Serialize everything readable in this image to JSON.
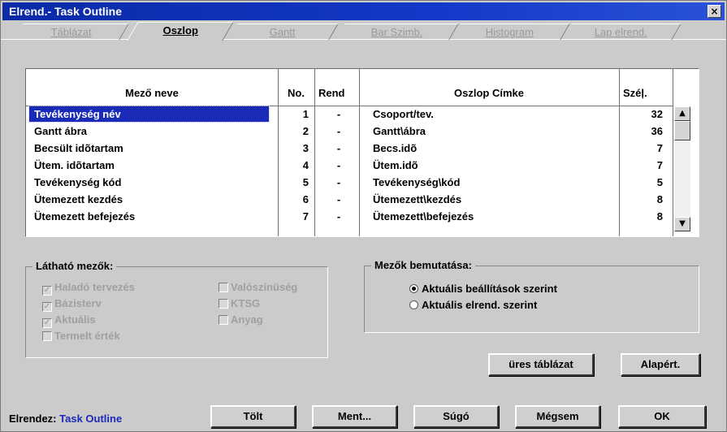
{
  "window": {
    "title": "Elrend.- Task Outline",
    "close_glyph": "×"
  },
  "tabs": [
    {
      "label": "Táblázat",
      "active": false
    },
    {
      "label": "Oszlop",
      "active": true
    },
    {
      "label": "Gantt",
      "active": false
    },
    {
      "label": "Bar Szimb.",
      "active": false
    },
    {
      "label": "Histogram",
      "active": false
    },
    {
      "label": "Lap elrend.",
      "active": false
    }
  ],
  "grid": {
    "headers": {
      "field": "Mező neve",
      "no": "No.",
      "order": "Rend",
      "label": "Oszlop Címke",
      "width": "Széļ."
    },
    "rows": [
      {
        "field": "Tevékenység név",
        "no": "1",
        "order": "-",
        "label": "Csoport/tev.",
        "width": "32",
        "selected": true
      },
      {
        "field": "Gantt ábra",
        "no": "2",
        "order": "-",
        "label": "Gantt\\ábra",
        "width": "36"
      },
      {
        "field": "Becsült idõtartam",
        "no": "3",
        "order": "-",
        "label": "Becs.idõ",
        "width": "7"
      },
      {
        "field": "Ütem. idõtartam",
        "no": "4",
        "order": "-",
        "label": "Ütem.idõ",
        "width": "7"
      },
      {
        "field": "Tevékenység kód",
        "no": "5",
        "order": "-",
        "label": "Tevékenység\\kód",
        "width": "5"
      },
      {
        "field": "Ütemezett kezdés",
        "no": "6",
        "order": "-",
        "label": "Ütemezett\\kezdés",
        "width": "8"
      },
      {
        "field": "Ütemezett befejezés",
        "no": "7",
        "order": "-",
        "label": "Ütemezett\\befejezés",
        "width": "8"
      }
    ],
    "scroll_up": "▲",
    "scroll_down": "▼"
  },
  "visible_fields": {
    "title": "Látható mezők:",
    "items": [
      {
        "label": "Haladó tervezés",
        "checked": true
      },
      {
        "label": "Bázisterv",
        "checked": true
      },
      {
        "label": "Aktuális",
        "checked": true
      },
      {
        "label": "Termelt érték",
        "checked": false
      },
      {
        "label": "Valószínüség",
        "checked": false
      },
      {
        "label": "KTSG",
        "checked": false
      },
      {
        "label": "Anyag",
        "checked": false
      }
    ],
    "check_glyph": "✓"
  },
  "field_display": {
    "title": "Mezők bemutatása:",
    "options": [
      {
        "label": "Aktuális beállítások szerint",
        "selected": true
      },
      {
        "label": "Aktuális elrend. szerint",
        "selected": false
      }
    ]
  },
  "buttons": {
    "empty_table": "üres táblázat",
    "defaults": "Alapért.",
    "load": "Tölt",
    "save": "Ment...",
    "help": "Súgó",
    "cancel": "Mégsem",
    "ok": "OK"
  },
  "status": {
    "label": "Elrendez:",
    "value": "Task Outline"
  }
}
